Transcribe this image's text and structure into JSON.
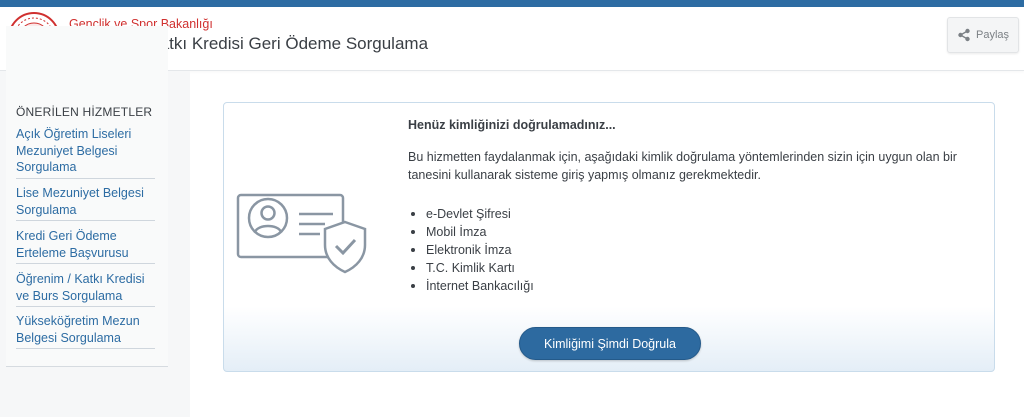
{
  "header": {
    "ministry": "Gençlik ve Spor Bakanlığı",
    "title": "Öğrenim / Katkı Kredisi Geri Ödeme Sorgulama",
    "share_label": "Paylaş"
  },
  "sidebar": {
    "title": "ÖNERİLEN HİZMETLER",
    "items": [
      {
        "label": "Açık Öğretim Liseleri Mezuniyet Belgesi Sorgulama"
      },
      {
        "label": "Lise Mezuniyet Belgesi Sorgulama"
      },
      {
        "label": "Kredi Geri Ödeme Erteleme Başvurusu"
      },
      {
        "label": "Öğrenim / Katkı Kredisi ve Burs Sorgulama"
      },
      {
        "label": "Yükseköğretim Mezun Belgesi Sorgulama"
      }
    ]
  },
  "main": {
    "title": "Henüz kimliğinizi doğrulamadınız...",
    "description": "Bu hizmetten faydalanmak için, aşağıdaki kimlik doğrulama yöntemlerinden sizin için uygun olan bir tanesini kullanarak sisteme giriş yapmış olmanız gerekmektedir.",
    "methods": [
      "e-Devlet Şifresi",
      "Mobil İmza",
      "Elektronik İmza",
      "T.C. Kimlik Kartı",
      "İnternet Bankacılığı"
    ],
    "verify_button": "Kimliğimi Şimdi Doğrula"
  },
  "colors": {
    "topbar": "#2d6ca3",
    "ministry_red": "#d0302f",
    "link_blue": "#2d6ca3",
    "button_blue": "#2d6aa0"
  },
  "icons": {
    "logo": "ministry-logo",
    "share": "share-icon",
    "illustration": "identity-card-shield-icon"
  }
}
